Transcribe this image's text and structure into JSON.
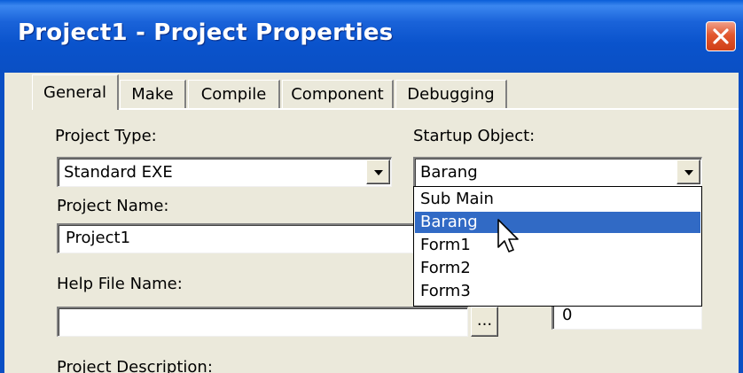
{
  "window": {
    "title": "Project1 - Project Properties"
  },
  "tabs": [
    {
      "label": "General",
      "active": true
    },
    {
      "label": "Make",
      "active": false
    },
    {
      "label": "Compile",
      "active": false
    },
    {
      "label": "Component",
      "active": false
    },
    {
      "label": "Debugging",
      "active": false
    }
  ],
  "form": {
    "project_type_label": "Project Type:",
    "project_type_value": "Standard EXE",
    "startup_object_label": "Startup Object:",
    "startup_object_value": "Barang",
    "project_name_label": "Project Name:",
    "project_name_value": "Project1",
    "help_file_label": "Help File Name:",
    "help_file_value": "",
    "help_context_value": "0",
    "ellipsis_label": "...",
    "project_description_label": "Project Description:"
  },
  "dropdown": {
    "items": [
      "Sub Main",
      "Barang",
      "Form1",
      "Form2",
      "Form3"
    ],
    "selected_index": 1
  },
  "icons": {
    "close": "close-icon",
    "dropdown_arrow": "chevron-down-icon",
    "cursor": "mouse-pointer-icon"
  },
  "colors": {
    "titlebar": "#0a53cc",
    "dialog_bg": "#ebe9db",
    "selection": "#316ac5",
    "close_button": "#e2582f"
  }
}
